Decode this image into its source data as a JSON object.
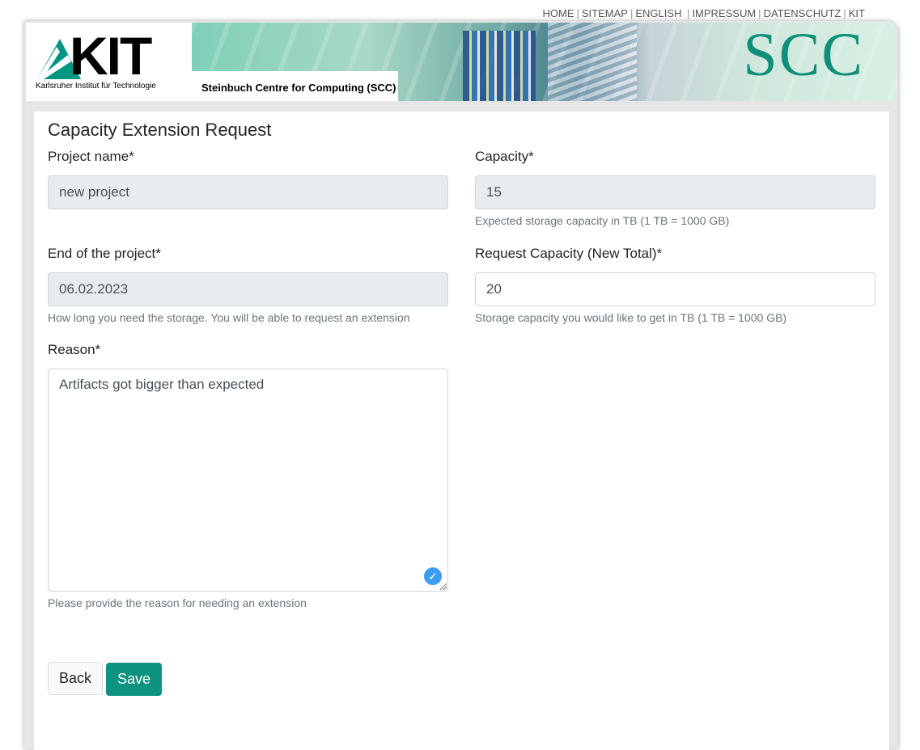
{
  "top_nav": {
    "items": [
      "HOME",
      "SITEMAP",
      "ENGLISH",
      "IMPRESSUM",
      "DATENSCHUTZ",
      "KIT"
    ]
  },
  "header": {
    "logo_text": "KIT",
    "logo_subtitle": "Karlsruher Institut für Technologie",
    "banner_label": "Steinbuch Centre for Computing (SCC)",
    "banner_logo": "SCC"
  },
  "form": {
    "title": "Capacity Extension Request",
    "project_name": {
      "label": "Project name*",
      "value": "new project"
    },
    "capacity": {
      "label": "Capacity*",
      "value": "15",
      "help": "Expected storage capacity in TB (1 TB = 1000 GB)"
    },
    "end_of_project": {
      "label": "End of the project*",
      "value": "06.02.2023",
      "help": "How long you need the storage. You will be able to request an extension"
    },
    "requested_capacity": {
      "label": "Request Capacity (New Total)*",
      "value": "20",
      "help": "Storage capacity you would like to get in TB (1 TB = 1000 GB)"
    },
    "reason": {
      "label": "Reason*",
      "value": "Artifacts got bigger than expected",
      "help": "Please provide the reason for needing an extension"
    },
    "buttons": {
      "back": "Back",
      "save": "Save"
    }
  },
  "colors": {
    "accent": "#0e9380",
    "readonly_bg": "#e9ecef"
  }
}
